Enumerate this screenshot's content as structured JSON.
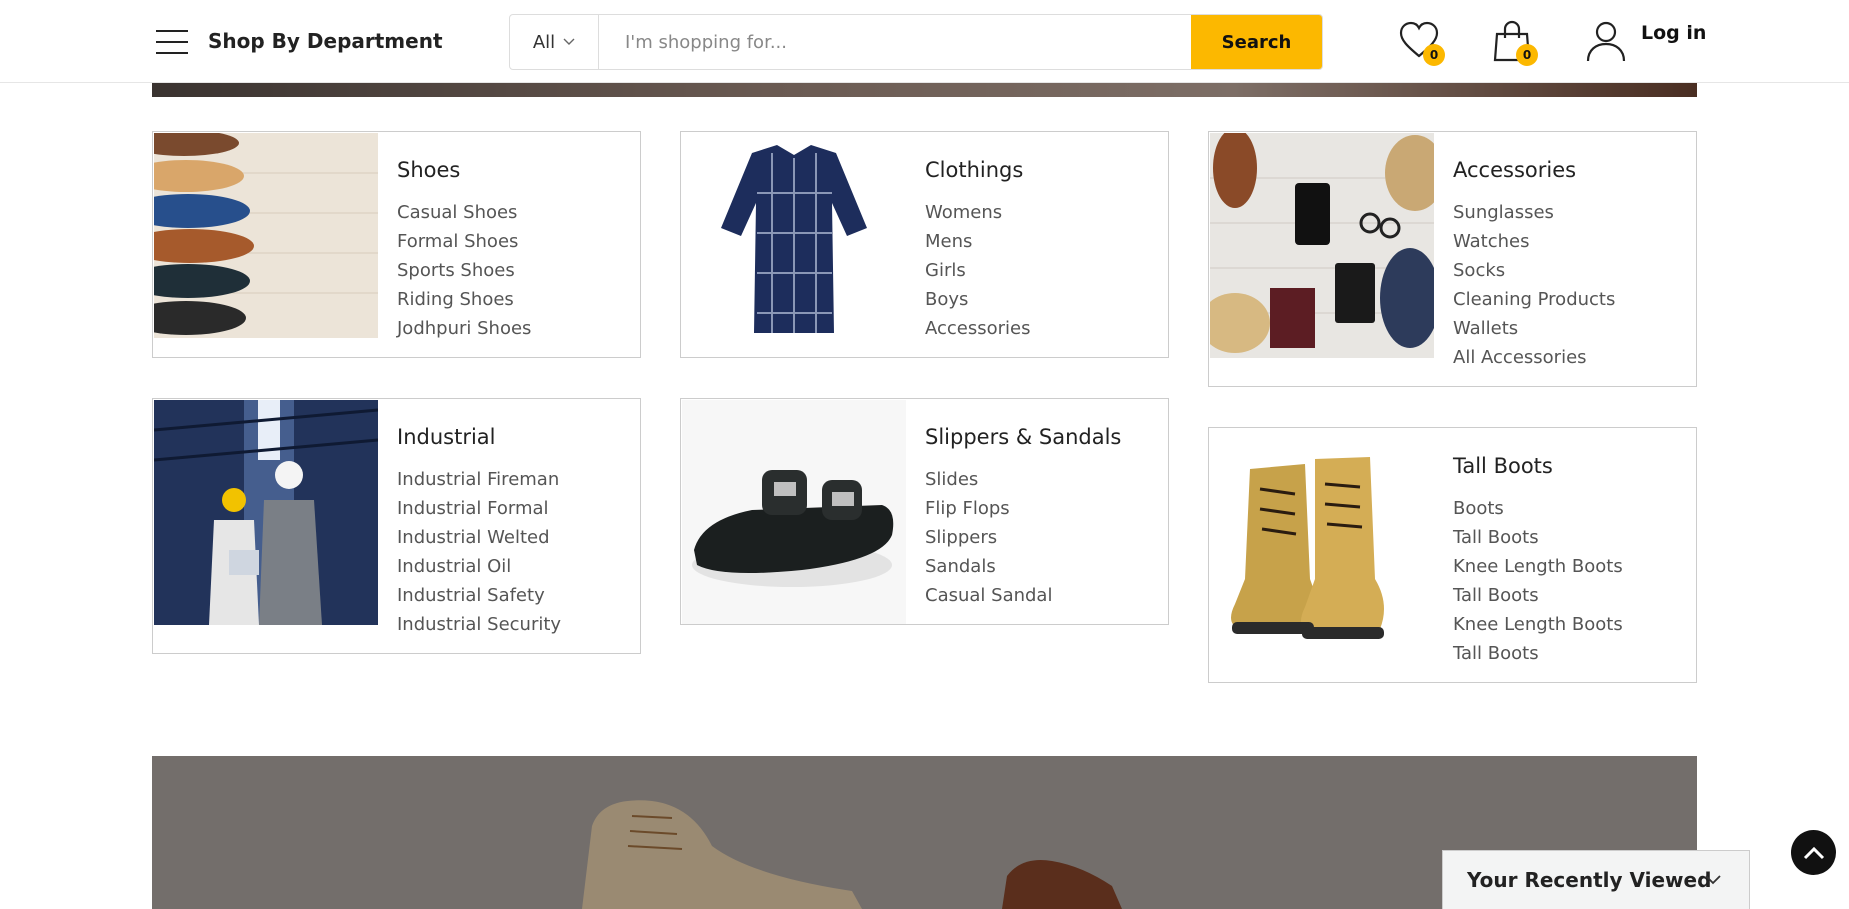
{
  "header": {
    "department_label": "Shop By Department",
    "search": {
      "category": "All",
      "placeholder": "I'm shopping for...",
      "button_label": "Search"
    },
    "wishlist_count": "0",
    "cart_count": "0",
    "login_label": "Log in"
  },
  "categories": [
    {
      "title": "Shoes",
      "items": [
        "Casual Shoes",
        "Formal Shoes",
        "Sports Shoes",
        "Riding Shoes",
        "Jodhpuri Shoes"
      ]
    },
    {
      "title": "Clothings",
      "items": [
        "Womens",
        "Mens",
        "Girls",
        "Boys",
        "Accessories"
      ]
    },
    {
      "title": "Accessories",
      "items": [
        "Sunglasses",
        "Watches",
        "Socks",
        "Cleaning Products",
        "Wallets",
        "All Accessories"
      ]
    },
    {
      "title": "Industrial",
      "items": [
        "Industrial Fireman",
        "Industrial Formal",
        "Industrial Welted",
        "Industrial Oil",
        "Industrial Safety",
        "Industrial Security"
      ]
    },
    {
      "title": "Slippers & Sandals",
      "items": [
        "Slides",
        "Flip Flops",
        "Slippers",
        "Sandals",
        "Casual Sandal"
      ]
    },
    {
      "title": "Tall Boots",
      "items": [
        "Boots",
        "Tall Boots",
        "Knee Length Boots",
        "Tall Boots",
        "Knee Length Boots",
        "Tall Boots"
      ]
    }
  ],
  "recently_viewed": {
    "label": "Your Recently Viewed"
  },
  "colors": {
    "accent": "#fcb800",
    "text": "#222222",
    "muted": "#555555",
    "border": "#cccccc"
  }
}
